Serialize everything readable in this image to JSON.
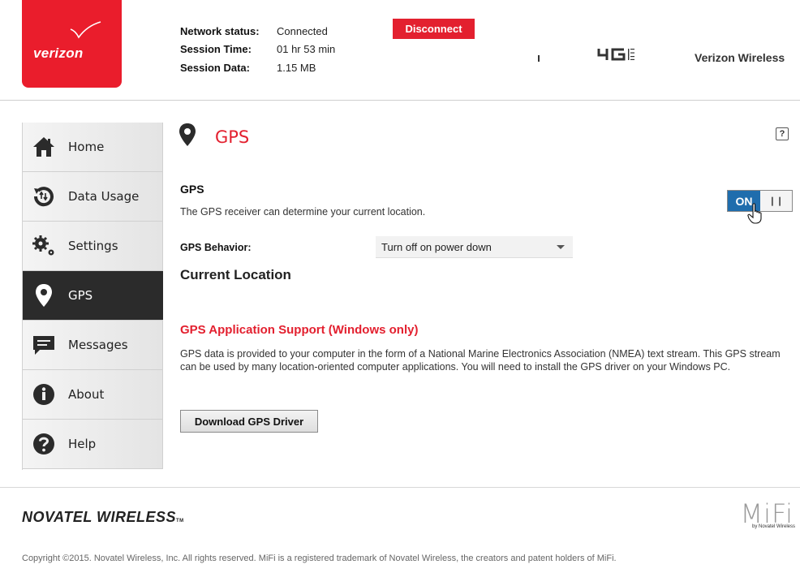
{
  "brand": {
    "logo_text": "verizon",
    "carrier": "Verizon Wireless",
    "network_badge": "4G LTE"
  },
  "status": {
    "network_label": "Network status:",
    "network_value": "Connected",
    "session_time_label": "Session Time:",
    "session_time_value": "01 hr 53 min",
    "session_data_label": "Session Data:",
    "session_data_value": "1.15 MB",
    "disconnect_label": "Disconnect"
  },
  "sidebar": {
    "items": [
      {
        "label": "Home",
        "icon": "home-icon"
      },
      {
        "label": "Data Usage",
        "icon": "data-usage-icon"
      },
      {
        "label": "Settings",
        "icon": "settings-icon"
      },
      {
        "label": "GPS",
        "icon": "location-pin-icon",
        "active": true
      },
      {
        "label": "Messages",
        "icon": "message-icon"
      },
      {
        "label": "About",
        "icon": "info-icon"
      },
      {
        "label": "Help",
        "icon": "help-icon"
      }
    ]
  },
  "main": {
    "title": "GPS",
    "help_glyph": "?",
    "gps_heading": "GPS",
    "gps_description": "The GPS receiver can determine your current location.",
    "toggle": {
      "on_label": "ON",
      "state": "on"
    },
    "behavior_label": "GPS Behavior:",
    "behavior_value": "Turn off on power down",
    "current_location_heading": "Current Location",
    "app_support_heading": "GPS Application Support (Windows only)",
    "app_support_text": "GPS data is provided to your computer in the form of a National Marine Electronics Association (NMEA) text stream. This GPS stream can be used by many location-oriented computer applications. You will need to install the GPS driver on your Windows PC.",
    "download_button": "Download GPS Driver"
  },
  "footer": {
    "company": "NOVATEL WIRELESS",
    "company_tm": "TM",
    "product_logo": "MiFi",
    "product_byline": "by Novatel Wireless",
    "copyright": "Copyright ©2015. Novatel Wireless, Inc. All rights reserved. MiFi is a registered trademark of Novatel Wireless, the creators and patent holders of MiFi."
  },
  "colors": {
    "accent_red": "#e3202f",
    "logo_red": "#ea1d2c",
    "toggle_blue": "#1f6dad",
    "sidebar_active": "#2b2b2b"
  }
}
